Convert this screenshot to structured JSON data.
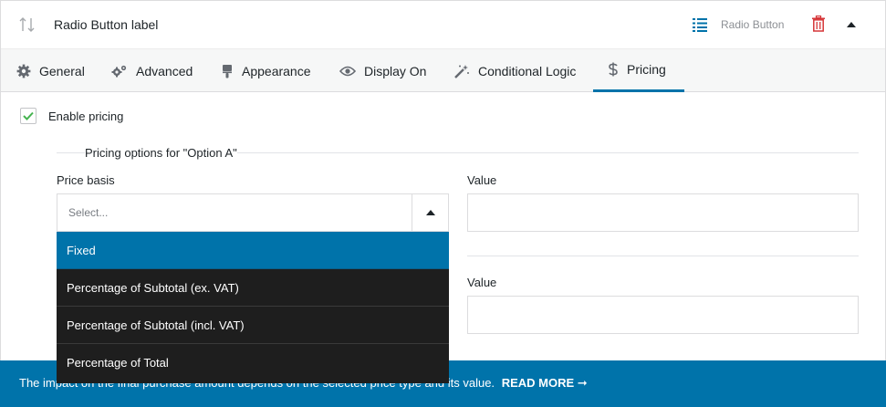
{
  "header": {
    "title": "Radio Button label",
    "type_label": "Radio Button",
    "icons": {
      "sort": "sort-arrows-icon",
      "type": "list-icon",
      "delete": "trash-icon",
      "collapse": "caret-up-icon"
    },
    "colors": {
      "delete": "#d63638",
      "type_icon": "#0073aa"
    }
  },
  "tabs": [
    {
      "label": "General",
      "icon": "gear-icon"
    },
    {
      "label": "Advanced",
      "icon": "gears-icon"
    },
    {
      "label": "Appearance",
      "icon": "paint-brush-icon"
    },
    {
      "label": "Display On",
      "icon": "eye-icon"
    },
    {
      "label": "Conditional Logic",
      "icon": "magic-wand-icon"
    },
    {
      "label": "Pricing",
      "icon": "dollar-icon",
      "active": true
    }
  ],
  "pricing": {
    "enable_label": "Enable pricing",
    "enabled": true,
    "legend": "Pricing options for \"Option A\"",
    "price_basis_label": "Price basis",
    "select_placeholder": "Select...",
    "value_label_1": "Value",
    "value_label_2": "Value",
    "options": [
      "Fixed",
      "Percentage of Subtotal (ex. VAT)",
      "Percentage of Subtotal (incl. VAT)",
      "Percentage of Total"
    ],
    "highlighted_option": "Fixed"
  },
  "banner": {
    "text": "The impact on the final purchase amount depends on the selected price type and its value.",
    "link_label": "READ MORE ➞"
  },
  "colors": {
    "accent": "#0073aa",
    "dropdown_bg": "#1e1e1e",
    "check": "#46b450"
  }
}
